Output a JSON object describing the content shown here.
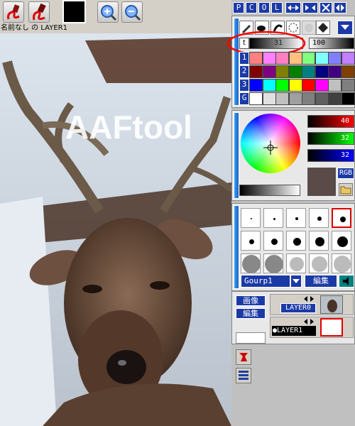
{
  "toolbar": {
    "pen_icon": "pen-icon",
    "eraser_icon": "eraser-icon",
    "color_swatch": "#000000",
    "zoom_in_icon": "zoom-in-icon",
    "zoom_out_icon": "zoom-out-icon"
  },
  "canvas": {
    "title": "名前なし の LAYER1",
    "watermark": "AAFtool"
  },
  "window_buttons": {
    "p": "P",
    "c": "C",
    "o": "O",
    "l": "L"
  },
  "tools": {
    "tone_value": "31",
    "opacity_value": "100",
    "row_labels": [
      "t",
      "1",
      "2",
      "3",
      "G"
    ]
  },
  "palette": {
    "rows": [
      [
        "#ffffff",
        "#ffc0c0",
        "#ffe0c0",
        "#ffffc0",
        "#c0ffc0",
        "#c0ffff",
        "#c0c0ff",
        "#ffc0ff"
      ],
      [
        "#ff8080",
        "#ff80ff",
        "#ff80c0",
        "#ffc080",
        "#80ff80",
        "#80ffff",
        "#8080ff",
        "#c080ff"
      ],
      [
        "#800000",
        "#800080",
        "#808000",
        "#008000",
        "#008080",
        "#000080",
        "#400080",
        "#804000"
      ],
      [
        "#0000ff",
        "#00ffff",
        "#00ff00",
        "#ffff00",
        "#ff0000",
        "#ff00ff",
        "#c0c0c0",
        "#808080"
      ],
      [
        "#ffffff",
        "#e0e0e0",
        "#c0c0c0",
        "#a0a0a0",
        "#808080",
        "#606060",
        "#404040",
        "#000000"
      ]
    ]
  },
  "color": {
    "r": "40",
    "g": "32",
    "b": "32",
    "mode_label": "RGB",
    "current": "#5a4a48"
  },
  "brushes": {
    "group_label": "Gourp1",
    "edit_label": "編集"
  },
  "layers": {
    "image_label": "画像",
    "edit_label": "編集",
    "items": [
      {
        "name": "LAYER0"
      },
      {
        "name": "LAYER1"
      }
    ]
  }
}
